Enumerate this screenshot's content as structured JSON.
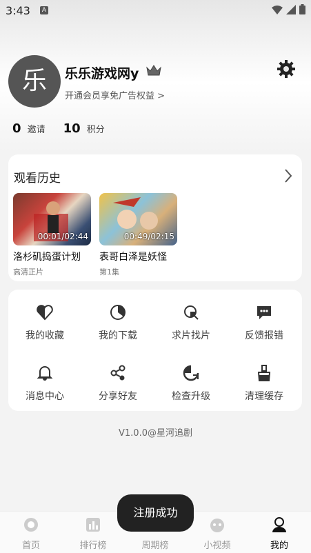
{
  "status": {
    "time": "3:43",
    "a": "A"
  },
  "profile": {
    "avatar_char": "乐",
    "name": "乐乐游戏网y",
    "vip_link": "开通会员享免广告权益 >"
  },
  "stats": [
    {
      "num": "0",
      "label": "邀请"
    },
    {
      "num": "10",
      "label": "积分"
    }
  ],
  "history": {
    "title": "观看历史",
    "items": [
      {
        "time": "00:01/02:44",
        "title": "洛杉矶捣蛋计划",
        "sub": "高清正片"
      },
      {
        "time": "00:49/02:15",
        "title": "表哥白泽是妖怪",
        "sub": "第1集"
      }
    ]
  },
  "grid": [
    {
      "icon": "heart-icon",
      "label": "我的收藏"
    },
    {
      "icon": "download-icon",
      "label": "我的下载"
    },
    {
      "icon": "search-film-icon",
      "label": "求片找片"
    },
    {
      "icon": "feedback-icon",
      "label": "反馈报错"
    },
    {
      "icon": "bell-icon",
      "label": "消息中心"
    },
    {
      "icon": "share-icon",
      "label": "分享好友"
    },
    {
      "icon": "upgrade-icon",
      "label": "检查升级"
    },
    {
      "icon": "broom-icon",
      "label": "清理缓存"
    }
  ],
  "version": "V1.0.0@星河追剧",
  "tabs": [
    {
      "icon": "home-icon",
      "label": "首页"
    },
    {
      "icon": "ranking-icon",
      "label": "排行榜"
    },
    {
      "icon": "weekly-icon",
      "label": "周期榜"
    },
    {
      "icon": "short-video-icon",
      "label": "小视频"
    },
    {
      "icon": "mine-icon",
      "label": "我的"
    }
  ],
  "toast": "注册成功"
}
